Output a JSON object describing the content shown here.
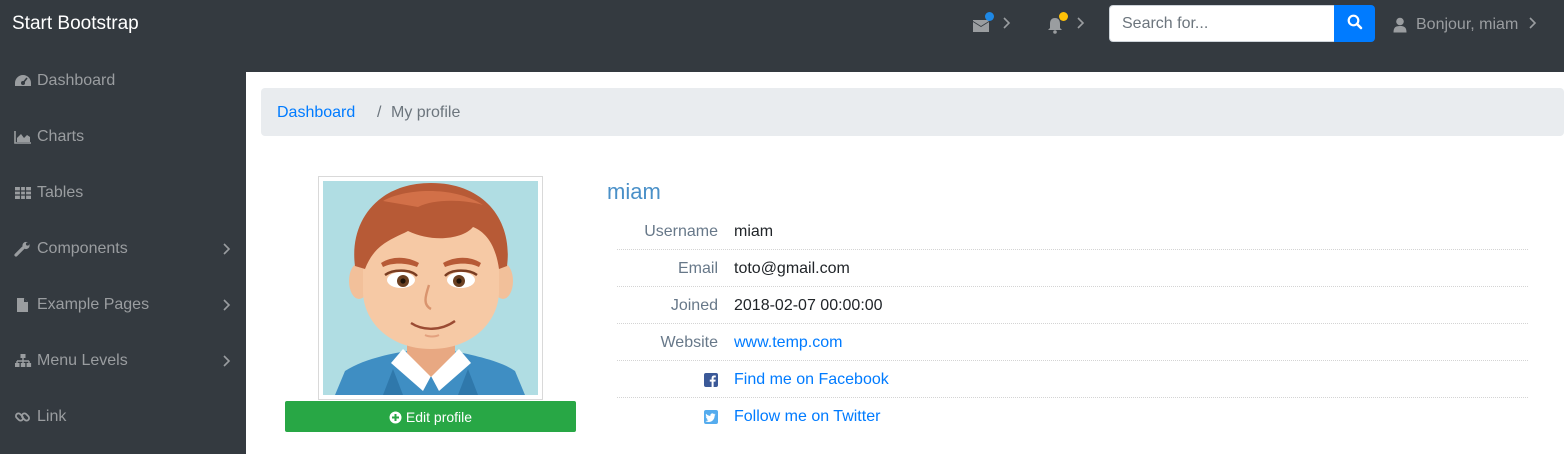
{
  "navbar": {
    "brand": "Start Bootstrap",
    "messages_icon": "envelope-icon",
    "messages_badge_color": "#1e88e5",
    "alerts_icon": "bell-icon",
    "alerts_badge_color": "#ffc107",
    "search": {
      "placeholder": "Search for...",
      "value": "",
      "button_icon": "search-icon"
    },
    "user": {
      "icon": "user-icon",
      "label": "Bonjour, miam"
    }
  },
  "sidebar": {
    "items": [
      {
        "label": "Dashboard",
        "icon": "tachometer-icon",
        "has_submenu": false
      },
      {
        "label": "Charts",
        "icon": "area-chart-icon",
        "has_submenu": false
      },
      {
        "label": "Tables",
        "icon": "table-icon",
        "has_submenu": false
      },
      {
        "label": "Components",
        "icon": "wrench-icon",
        "has_submenu": true
      },
      {
        "label": "Example Pages",
        "icon": "file-icon",
        "has_submenu": true
      },
      {
        "label": "Menu Levels",
        "icon": "sitemap-icon",
        "has_submenu": true
      },
      {
        "label": "Link",
        "icon": "link-icon",
        "has_submenu": false
      }
    ]
  },
  "breadcrumb": {
    "link": "Dashboard",
    "separator": "/",
    "current": "My profile"
  },
  "profile": {
    "name": "miam",
    "avatar_icon": "cartoon-avatar",
    "edit_button": "Edit profile",
    "rows": [
      {
        "label": "Username",
        "value": "miam"
      },
      {
        "label": "Email",
        "value": "toto@gmail.com"
      },
      {
        "label": "Joined",
        "value": "2018-02-07 00:00:00"
      },
      {
        "label": "Website",
        "value": "www.temp.com"
      }
    ],
    "facebook": "Find me on Facebook",
    "twitter": "Follow me on Twitter"
  },
  "colors": {
    "navbar_bg": "#343a40",
    "primary": "#007bff",
    "success": "#28a745",
    "breadcrumb_bg": "#e9ecef",
    "name_color": "#4a90c8",
    "facebook": "#3b5998",
    "twitter": "#55acee"
  }
}
